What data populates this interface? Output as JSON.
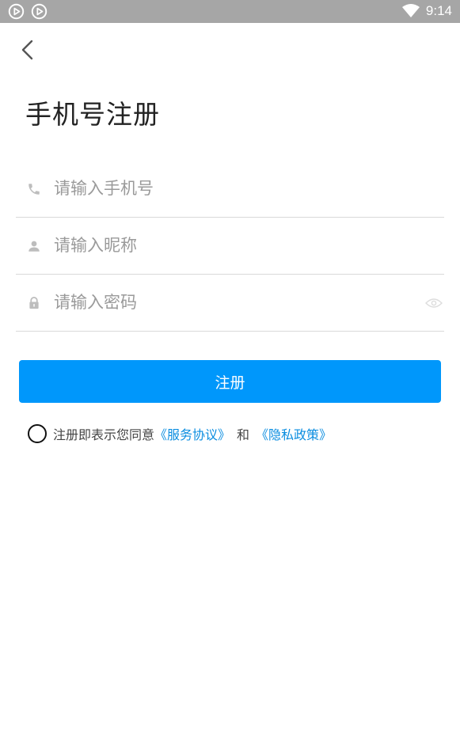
{
  "status_bar": {
    "left_icons": [
      "play-circle-icon",
      "play-circle-icon"
    ],
    "wifi_icon": "wifi-icon",
    "time": "9:14"
  },
  "header": {
    "back_icon": "chevron-left-icon",
    "title": "手机号注册"
  },
  "form": {
    "phone": {
      "icon": "phone-icon",
      "placeholder": "请输入手机号",
      "value": ""
    },
    "nickname": {
      "icon": "user-icon",
      "placeholder": "请输入昵称",
      "value": ""
    },
    "password": {
      "icon": "lock-icon",
      "placeholder": "请输入密码",
      "value": "",
      "toggle_icon": "eye-icon"
    }
  },
  "register_button": {
    "label": "注册",
    "color": "#0097fb"
  },
  "agreement": {
    "text": "注册即表示您同意",
    "terms_link": "《服务协议》",
    "and": "和",
    "privacy_link": "《隐私政策》",
    "link_color": "#0a8de0"
  }
}
